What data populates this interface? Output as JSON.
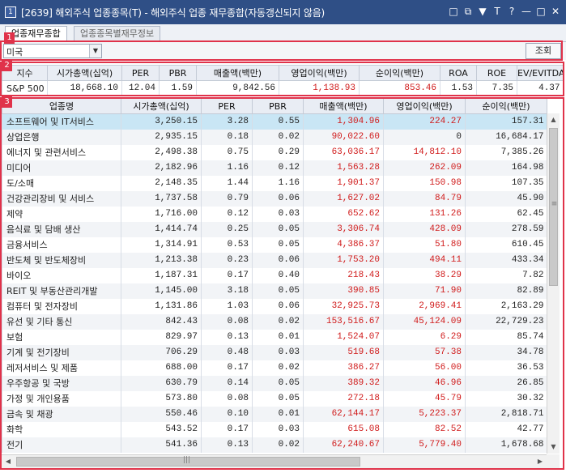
{
  "window": {
    "title": "[2639] 해외주식 업종종목(T) - 해외주식 업종 재무종합(자동갱신되지 않음)",
    "controls": [
      "□",
      "⧉",
      "▼",
      "T",
      "?",
      "—",
      "□",
      "✕"
    ]
  },
  "tabs": [
    {
      "label": "업종재무종합",
      "active": true
    },
    {
      "label": "업종종목별재무정보",
      "active": false
    }
  ],
  "markers": [
    "1",
    "2",
    "3"
  ],
  "market_select": {
    "value": "미국"
  },
  "search_button": "조회",
  "summary": {
    "headers": [
      "지수",
      "시가총액(십억)",
      "PER",
      "PBR",
      "매출액(백만)",
      "영업이익(백만)",
      "순이익(백만)",
      "ROA",
      "ROE",
      "EV/EVITDA"
    ],
    "row": [
      "S&P 500",
      "18,668.10",
      "12.04",
      "1.59",
      "9,842.56",
      "1,138.93",
      "853.46",
      "1.53",
      "7.35",
      "4.37"
    ]
  },
  "industry": {
    "headers": [
      "업종명",
      "시가총액(십억)",
      "PER",
      "PBR",
      "매출액(백만)",
      "영업이익(백만)",
      "순이익(백만)"
    ],
    "rows": [
      [
        "소프트웨어 및 IT서비스",
        "3,250.15",
        "3.28",
        "0.55",
        "1,304.96",
        "224.27",
        "157.31"
      ],
      [
        "상업은행",
        "2,935.15",
        "0.18",
        "0.02",
        "90,022.60",
        "0",
        "16,684.17"
      ],
      [
        "에너지 및 관련서비스",
        "2,498.38",
        "0.75",
        "0.29",
        "63,036.17",
        "14,812.10",
        "7,385.26"
      ],
      [
        "미디어",
        "2,182.96",
        "1.16",
        "0.12",
        "1,563.28",
        "262.09",
        "164.98"
      ],
      [
        "도/소매",
        "2,148.35",
        "1.44",
        "1.16",
        "1,901.37",
        "150.98",
        "107.35"
      ],
      [
        "건강관리장비 및 서비스",
        "1,737.58",
        "0.79",
        "0.06",
        "1,627.02",
        "84.79",
        "45.90"
      ],
      [
        "제약",
        "1,716.00",
        "0.12",
        "0.03",
        "652.62",
        "131.26",
        "62.45"
      ],
      [
        "음식료 및 담배 생산",
        "1,414.74",
        "0.25",
        "0.05",
        "3,306.74",
        "428.09",
        "278.59"
      ],
      [
        "금융서비스",
        "1,314.91",
        "0.53",
        "0.05",
        "4,386.37",
        "51.80",
        "610.45"
      ],
      [
        "반도체 및 반도체장비",
        "1,213.38",
        "0.23",
        "0.06",
        "1,753.20",
        "494.11",
        "433.34"
      ],
      [
        "바이오",
        "1,187.31",
        "0.17",
        "0.40",
        "218.43",
        "38.29",
        "7.82"
      ],
      [
        "REIT 및 부동산관리개발",
        "1,145.00",
        "3.18",
        "0.05",
        "390.85",
        "71.90",
        "82.89"
      ],
      [
        "컴퓨터 및 전자장비",
        "1,131.86",
        "1.03",
        "0.06",
        "32,925.73",
        "2,969.41",
        "2,163.29"
      ],
      [
        "유선 및 기타 통신",
        "842.43",
        "0.08",
        "0.02",
        "153,516.67",
        "45,124.09",
        "22,729.23"
      ],
      [
        "보험",
        "829.97",
        "0.13",
        "0.01",
        "1,524.07",
        "6.29",
        "85.74"
      ],
      [
        "기계 및 전기장비",
        "706.29",
        "0.48",
        "0.03",
        "519.68",
        "57.38",
        "34.78"
      ],
      [
        "레저서비스 및 제품",
        "688.00",
        "0.17",
        "0.02",
        "386.27",
        "56.00",
        "36.53"
      ],
      [
        "우주항공 및 국방",
        "630.79",
        "0.14",
        "0.05",
        "389.32",
        "46.96",
        "26.85"
      ],
      [
        "가정 및 개인용품",
        "573.80",
        "0.08",
        "0.05",
        "272.18",
        "45.79",
        "30.32"
      ],
      [
        "금속 및 채광",
        "550.46",
        "0.10",
        "0.01",
        "62,144.17",
        "5,223.37",
        "2,818.71"
      ],
      [
        "화학",
        "543.52",
        "0.17",
        "0.03",
        "615.08",
        "82.52",
        "42.77"
      ],
      [
        "전기",
        "541.36",
        "0.13",
        "0.02",
        "62,240.67",
        "5,779.40",
        "1,678.68"
      ]
    ]
  },
  "colors": {
    "titlebar": "#2f4f86",
    "highlight": "#e0324a",
    "negative_red": "#d01a1a",
    "selected_row": "#c9e6f5"
  }
}
